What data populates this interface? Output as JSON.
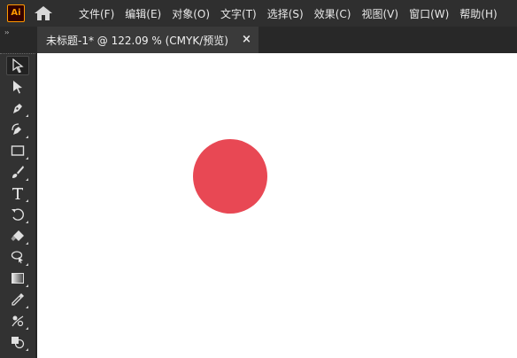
{
  "app": {
    "logo_text": "Ai",
    "logo_color": "#ff9a00"
  },
  "menu": {
    "items": [
      {
        "label": "文件(F)"
      },
      {
        "label": "编辑(E)"
      },
      {
        "label": "对象(O)"
      },
      {
        "label": "文字(T)"
      },
      {
        "label": "选择(S)"
      },
      {
        "label": "效果(C)"
      },
      {
        "label": "视图(V)"
      },
      {
        "label": "窗口(W)"
      },
      {
        "label": "帮助(H)"
      }
    ]
  },
  "document": {
    "tab_title": "未标题-1* @ 122.09 % (CMYK/预览)",
    "close_glyph": "×"
  },
  "toolbar": {
    "grip_glyph": "››",
    "tools": [
      {
        "name": "selection-tool",
        "icon": "arrow-outline-icon",
        "selected": true
      },
      {
        "name": "direct-selection-tool",
        "icon": "arrow-filled-icon"
      },
      {
        "name": "pen-tool",
        "icon": "pen-icon"
      },
      {
        "name": "curvature-tool",
        "icon": "curvature-pen-icon"
      },
      {
        "name": "rectangle-tool",
        "icon": "rectangle-icon"
      },
      {
        "name": "paintbrush-tool",
        "icon": "brush-icon"
      },
      {
        "name": "type-tool",
        "icon": "type-icon"
      },
      {
        "name": "rotate-tool",
        "icon": "rotate-icon"
      },
      {
        "name": "eraser-tool",
        "icon": "eraser-icon"
      },
      {
        "name": "lasso-tool",
        "icon": "lasso-icon"
      },
      {
        "name": "gradient-tool",
        "icon": "gradient-icon"
      },
      {
        "name": "eyedropper-tool",
        "icon": "eyedropper-icon"
      },
      {
        "name": "blend-tool",
        "icon": "blend-icon"
      },
      {
        "name": "shape-builder-tool",
        "icon": "shape-builder-icon"
      }
    ]
  },
  "canvas": {
    "background": "#ffffff",
    "shape": {
      "type": "circle",
      "fill": "#e84854"
    }
  }
}
